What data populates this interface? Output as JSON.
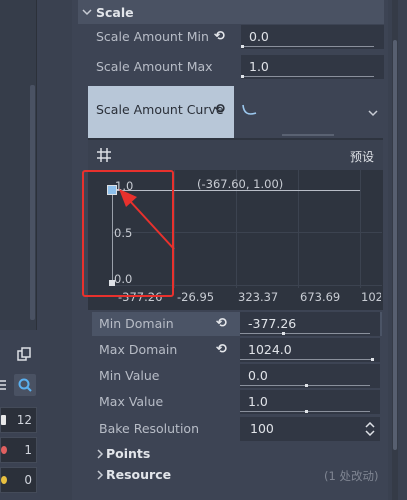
{
  "left_panel": {
    "icons": [
      "duplicate-icon",
      "list-icon",
      "search-icon"
    ],
    "rows": [
      {
        "value": "12",
        "color": "#e8e8e8"
      },
      {
        "value": "1",
        "color": "#e06060"
      },
      {
        "value": "0",
        "color": "#e8c040"
      }
    ]
  },
  "section": {
    "title": "Scale"
  },
  "props": {
    "scale_amount_min": {
      "label": "Scale Amount Min",
      "value": "0.0"
    },
    "scale_amount_max": {
      "label": "Scale Amount Max",
      "value": "1.0"
    },
    "scale_amount_curve": {
      "label": "Scale Amount Curve"
    }
  },
  "curve_editor": {
    "preset_label": "预设",
    "cursor_readout": "(-367.60, 1.00)",
    "y_ticks": [
      "1.0",
      "0.5",
      "0.0"
    ],
    "x_ticks": [
      "-377.26",
      "-26.95",
      "323.37",
      "673.69",
      "102"
    ],
    "points": [
      {
        "x": -377.26,
        "y": 1.0
      },
      {
        "x": -377.26,
        "y": 0.0
      }
    ]
  },
  "curve_props": {
    "min_domain": {
      "label": "Min Domain",
      "value": "-377.26"
    },
    "max_domain": {
      "label": "Max Domain",
      "value": "1024.0"
    },
    "min_value": {
      "label": "Min Value",
      "value": "0.0"
    },
    "max_value": {
      "label": "Max Value",
      "value": "1.0"
    },
    "bake_resolution": {
      "label": "Bake Resolution",
      "value": "100"
    }
  },
  "groups": {
    "points": "Points",
    "resource": "Resource",
    "resource_changes": "(1 处改动)"
  },
  "colors": {
    "accent": "#4fb0f0",
    "annotation": "#e8312d"
  }
}
